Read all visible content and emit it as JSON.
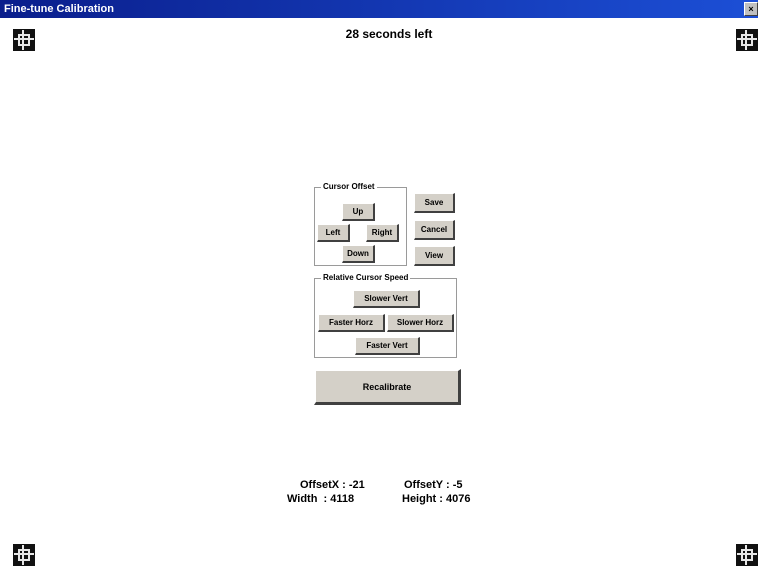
{
  "window": {
    "title": "Fine-tune Calibration",
    "close_label": "×"
  },
  "timer": {
    "text": "28 seconds left"
  },
  "cursor_offset": {
    "label": "Cursor Offset",
    "up": "Up",
    "left": "Left",
    "right": "Right",
    "down": "Down"
  },
  "actions": {
    "save": "Save",
    "cancel": "Cancel",
    "view": "View"
  },
  "relative_speed": {
    "label": "Relative Cursor Speed",
    "slower_vert": "Slower Vert",
    "faster_horz": "Faster Horz",
    "slower_horz": "Slower Horz",
    "faster_vert": "Faster Vert"
  },
  "recalibrate": {
    "label": "Recalibrate"
  },
  "readout": {
    "offset_x": "OffsetX : -21",
    "offset_y": "OffsetY : -5",
    "width": "Width  : 4118",
    "height": "Height : 4076"
  }
}
